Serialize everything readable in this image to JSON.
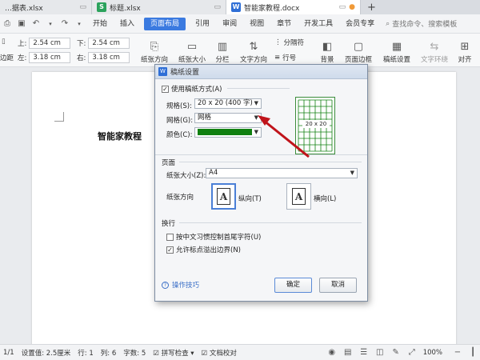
{
  "tabs": [
    {
      "name": "…据表.xlsx",
      "type": "S",
      "active": false
    },
    {
      "name": "标题.xlsx",
      "type": "S",
      "active": false
    },
    {
      "name": "智能家教程.docx",
      "type": "W",
      "active": true
    }
  ],
  "menu": {
    "items": [
      "开始",
      "插入",
      "页面布局",
      "引用",
      "审阅",
      "视图",
      "章节",
      "开发工具",
      "会员专享"
    ],
    "active": "页面布局",
    "search_placeholder": "查找命令、搜索模板"
  },
  "ribbon": {
    "margins": {
      "top_label": "上:",
      "top": "2.54 cm",
      "bottom_label": "下:",
      "bottom": "2.54 cm",
      "left_label": "左:",
      "left": "3.18 cm",
      "right_label": "右:",
      "right": "3.18 cm",
      "left_trunc": "边距"
    },
    "groups": [
      "纸张方向",
      "纸张大小",
      "分栏",
      "文字方向",
      "分隔符",
      "行号",
      "背景",
      "页面边框",
      "稿纸设置",
      "文字环绕",
      "对齐"
    ]
  },
  "document": {
    "title": "智能家教程"
  },
  "dialog": {
    "title": "稿纸设置",
    "use_grid": {
      "label": "使用稿纸方式(A)",
      "checked": true
    },
    "spec": {
      "label": "规格(S):",
      "value": "20 x 20 (400 字)"
    },
    "grid": {
      "label": "网格(G):",
      "value": "网格"
    },
    "color": {
      "label": "颜色(C):",
      "value": "#108010"
    },
    "preview_label": "20 x 20",
    "page_section": "页面",
    "paper_size": {
      "label": "纸张大小(Z):",
      "value": "A4"
    },
    "orientation": {
      "label": "纸张方向",
      "portrait": "纵向(T)",
      "landscape": "横向(L)",
      "selected": "portrait",
      "glyph": "A"
    },
    "wrap_section": "换行",
    "opt1": {
      "label": "按中文习惯控制首尾字符(U)",
      "checked": false
    },
    "opt2": {
      "label": "允许标点溢出边界(N)",
      "checked": true
    },
    "tip": "操作技巧",
    "ok": "确定",
    "cancel": "取消"
  },
  "status": {
    "page": "1/1",
    "setting": "设置值: 2.5厘米",
    "row": "行: 1",
    "col": "列: 6",
    "words": "字数: 5",
    "spell": "拼写检查",
    "doc_check": "文档校对",
    "zoom": "100%"
  },
  "colors": {
    "accent": "#3b7ae0",
    "green": "#108010",
    "arrow": "#c0141b"
  }
}
